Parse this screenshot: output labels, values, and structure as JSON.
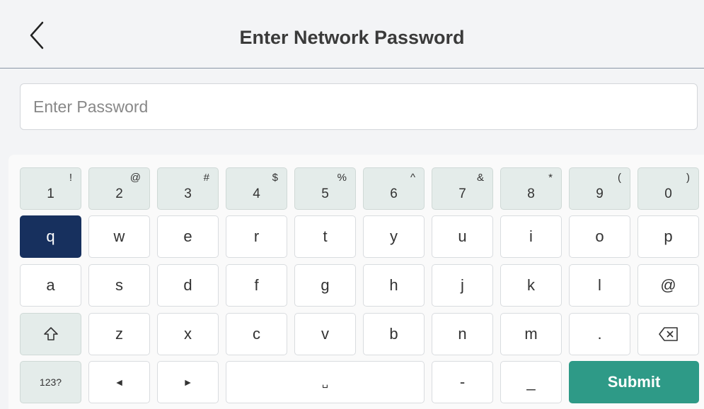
{
  "header": {
    "title": "Enter Network Password",
    "back_icon": "chevron-left-icon"
  },
  "password": {
    "placeholder": "Enter Password",
    "value": ""
  },
  "keyboard": {
    "row1": [
      {
        "main": "1",
        "alt": "!"
      },
      {
        "main": "2",
        "alt": "@"
      },
      {
        "main": "3",
        "alt": "#"
      },
      {
        "main": "4",
        "alt": "$"
      },
      {
        "main": "5",
        "alt": "%"
      },
      {
        "main": "6",
        "alt": "^"
      },
      {
        "main": "7",
        "alt": "&"
      },
      {
        "main": "8",
        "alt": "*"
      },
      {
        "main": "9",
        "alt": "("
      },
      {
        "main": "0",
        "alt": ")"
      }
    ],
    "row2": [
      "q",
      "w",
      "e",
      "r",
      "t",
      "y",
      "u",
      "i",
      "o",
      "p"
    ],
    "row3": [
      "a",
      "s",
      "d",
      "f",
      "g",
      "h",
      "j",
      "k",
      "l",
      "@"
    ],
    "row4": [
      "⇧",
      "z",
      "x",
      "c",
      "v",
      "b",
      "n",
      "m",
      ".",
      "⌫"
    ],
    "row5": {
      "mode": "123?",
      "left": "◄",
      "right": "►",
      "space": "␣",
      "dash": "-",
      "underscore": "_",
      "submit": "Submit"
    },
    "active_key": "q",
    "colors": {
      "active": "#17305e",
      "submit": "#2e9a87",
      "num_key": "#e4ecea"
    }
  }
}
